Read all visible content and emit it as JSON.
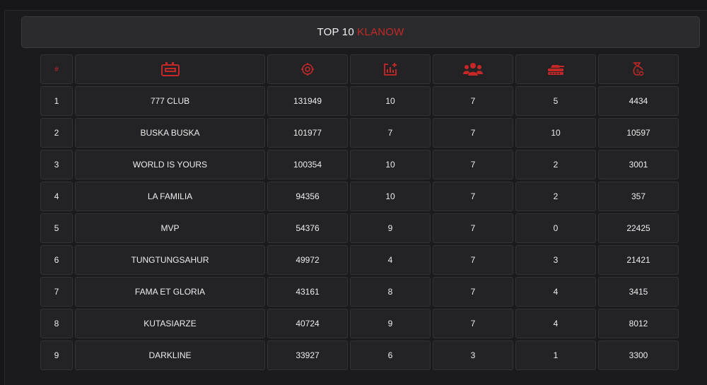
{
  "title": {
    "prefix": "TOP 10",
    "highlight": "KLANOW"
  },
  "columns": [
    {
      "label": "#",
      "icon": "hash-icon"
    },
    {
      "icon": "clan-banner-icon"
    },
    {
      "icon": "target-icon"
    },
    {
      "icon": "stats-chart-icon"
    },
    {
      "icon": "members-icon"
    },
    {
      "icon": "tank-icon"
    },
    {
      "icon": "money-bag-icon"
    }
  ],
  "accent_color": "#c62828",
  "rows": [
    {
      "rank": "1",
      "name": "777 CLUB",
      "points": "131949",
      "col3": "10",
      "members": "7",
      "col5": "5",
      "col6": "4434"
    },
    {
      "rank": "2",
      "name": "BUSKA BUSKA",
      "points": "101977",
      "col3": "7",
      "members": "7",
      "col5": "10",
      "col6": "10597"
    },
    {
      "rank": "3",
      "name": "WORLD IS YOURS",
      "points": "100354",
      "col3": "10",
      "members": "7",
      "col5": "2",
      "col6": "3001"
    },
    {
      "rank": "4",
      "name": "LA FAMILIA",
      "points": "94356",
      "col3": "10",
      "members": "7",
      "col5": "2",
      "col6": "357"
    },
    {
      "rank": "5",
      "name": "MVP",
      "points": "54376",
      "col3": "9",
      "members": "7",
      "col5": "0",
      "col6": "22425"
    },
    {
      "rank": "6",
      "name": "TUNGTUNGSAHUR",
      "points": "49972",
      "col3": "4",
      "members": "7",
      "col5": "3",
      "col6": "21421"
    },
    {
      "rank": "7",
      "name": "FAMA ET GLORIA",
      "points": "43161",
      "col3": "8",
      "members": "7",
      "col5": "4",
      "col6": "3415"
    },
    {
      "rank": "8",
      "name": "KUTASIARZE",
      "points": "40724",
      "col3": "9",
      "members": "7",
      "col5": "4",
      "col6": "8012"
    },
    {
      "rank": "9",
      "name": "DARKLINE",
      "points": "33927",
      "col3": "6",
      "members": "3",
      "col5": "1",
      "col6": "3300"
    }
  ]
}
